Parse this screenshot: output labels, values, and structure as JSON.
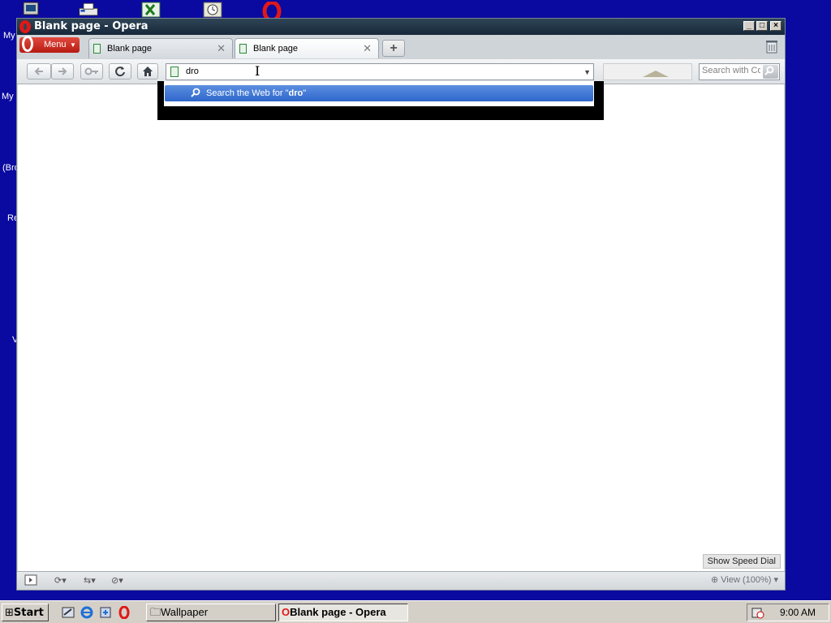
{
  "desktop": {
    "labels": [
      "My",
      "My",
      "(Bro",
      "Re",
      "V"
    ]
  },
  "window": {
    "title": "Blank page - Opera",
    "controls": {
      "minimize": "_",
      "maximize": "□",
      "close": "×"
    }
  },
  "menu": {
    "label": "Menu"
  },
  "tabs": [
    {
      "label": "Blank page",
      "active": false
    },
    {
      "label": "Blank page",
      "active": true
    }
  ],
  "toolbar": {
    "back_icon": "arrow-left-icon",
    "forward_icon": "arrow-right-icon",
    "key_icon": "key-icon",
    "reload_icon": "reload-icon",
    "home_icon": "home-icon"
  },
  "address": {
    "value": "dro"
  },
  "search": {
    "placeholder": "Search with Co"
  },
  "dropdown": {
    "prefix": "Search the Web for \"",
    "query": "dro",
    "suffix": "\""
  },
  "content": {
    "speed_dial": "Show Speed Dial"
  },
  "statusbar": {
    "zoom": "View (100%)"
  },
  "taskbar": {
    "start": "Start",
    "items": [
      {
        "label": "Wallpaper",
        "active": false
      },
      {
        "label": "Blank page - Opera",
        "active": true
      }
    ],
    "clock": "9:00 AM"
  },
  "colors": {
    "desktop": "#0a0aa0",
    "opera_red": "#e01818",
    "highlight": "#2f67cc"
  }
}
